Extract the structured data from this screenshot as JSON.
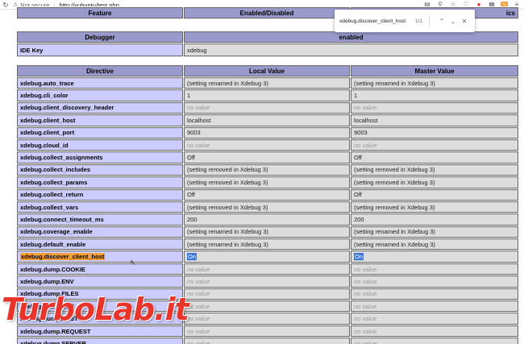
{
  "browser": {
    "security_label": "Not secure",
    "url": "http://vubuntu/test.php"
  },
  "findbar": {
    "query": "xdebug.discover_client_host",
    "count": "1/1"
  },
  "feature_table": {
    "headers": [
      "Feature",
      "Enabled/Disabled",
      "ics"
    ]
  },
  "debugger_table": {
    "headers": [
      "Debugger",
      "enabled"
    ],
    "rows": [
      {
        "key": "IDE Key",
        "value": "xdebug"
      }
    ]
  },
  "directive_table": {
    "headers": [
      "Directive",
      "Local Value",
      "Master Value"
    ],
    "rows": [
      {
        "name": "xdebug.auto_trace",
        "local": "(setting renamed in Xdebug 3)",
        "master": "(setting renamed in Xdebug 3)",
        "nv": false
      },
      {
        "name": "xdebug.cli_color",
        "local": "1",
        "master": "1",
        "nv": false
      },
      {
        "name": "xdebug.client_discovery_header",
        "local": "no value",
        "master": "no value",
        "nv": true
      },
      {
        "name": "xdebug.client_host",
        "local": "localhost",
        "master": "localhost",
        "nv": false
      },
      {
        "name": "xdebug.client_port",
        "local": "9003",
        "master": "9003",
        "nv": false
      },
      {
        "name": "xdebug.cloud_id",
        "local": "no value",
        "master": "no value",
        "nv": true
      },
      {
        "name": "xdebug.collect_assignments",
        "local": "Off",
        "master": "Off",
        "nv": false
      },
      {
        "name": "xdebug.collect_includes",
        "local": "(setting removed in Xdebug 3)",
        "master": "(setting removed in Xdebug 3)",
        "nv": false
      },
      {
        "name": "xdebug.collect_params",
        "local": "(setting removed in Xdebug 3)",
        "master": "(setting removed in Xdebug 3)",
        "nv": false
      },
      {
        "name": "xdebug.collect_return",
        "local": "Off",
        "master": "Off",
        "nv": false
      },
      {
        "name": "xdebug.collect_vars",
        "local": "(setting removed in Xdebug 3)",
        "master": "(setting removed in Xdebug 3)",
        "nv": false
      },
      {
        "name": "xdebug.connect_timeout_ms",
        "local": "200",
        "master": "200",
        "nv": false
      },
      {
        "name": "xdebug.coverage_enable",
        "local": "(setting renamed in Xdebug 3)",
        "master": "(setting renamed in Xdebug 3)",
        "nv": false
      },
      {
        "name": "xdebug.default_enable",
        "local": "(setting renamed in Xdebug 3)",
        "master": "(setting renamed in Xdebug 3)",
        "nv": false
      },
      {
        "name": "xdebug.discover_client_host",
        "local": "On",
        "master": "On",
        "nv": false,
        "highlight": true
      },
      {
        "name": "xdebug.dump.COOKIE",
        "local": "no value",
        "master": "no value",
        "nv": true
      },
      {
        "name": "xdebug.dump.ENV",
        "local": "no value",
        "master": "no value",
        "nv": true
      },
      {
        "name": "xdebug.dump.FILES",
        "local": "no value",
        "master": "no value",
        "nv": true
      },
      {
        "name": "xdebug.dump.GET",
        "local": "no value",
        "master": "no value",
        "nv": true
      },
      {
        "name": "xdebug.dump.POST",
        "local": "no value",
        "master": "no value",
        "nv": true
      },
      {
        "name": "xdebug.dump.REQUEST",
        "local": "no value",
        "master": "no value",
        "nv": true
      },
      {
        "name": "xdebug.dump.SERVER",
        "local": "no value",
        "master": "no value",
        "nv": true
      }
    ]
  },
  "watermark": "TurboLab.it"
}
